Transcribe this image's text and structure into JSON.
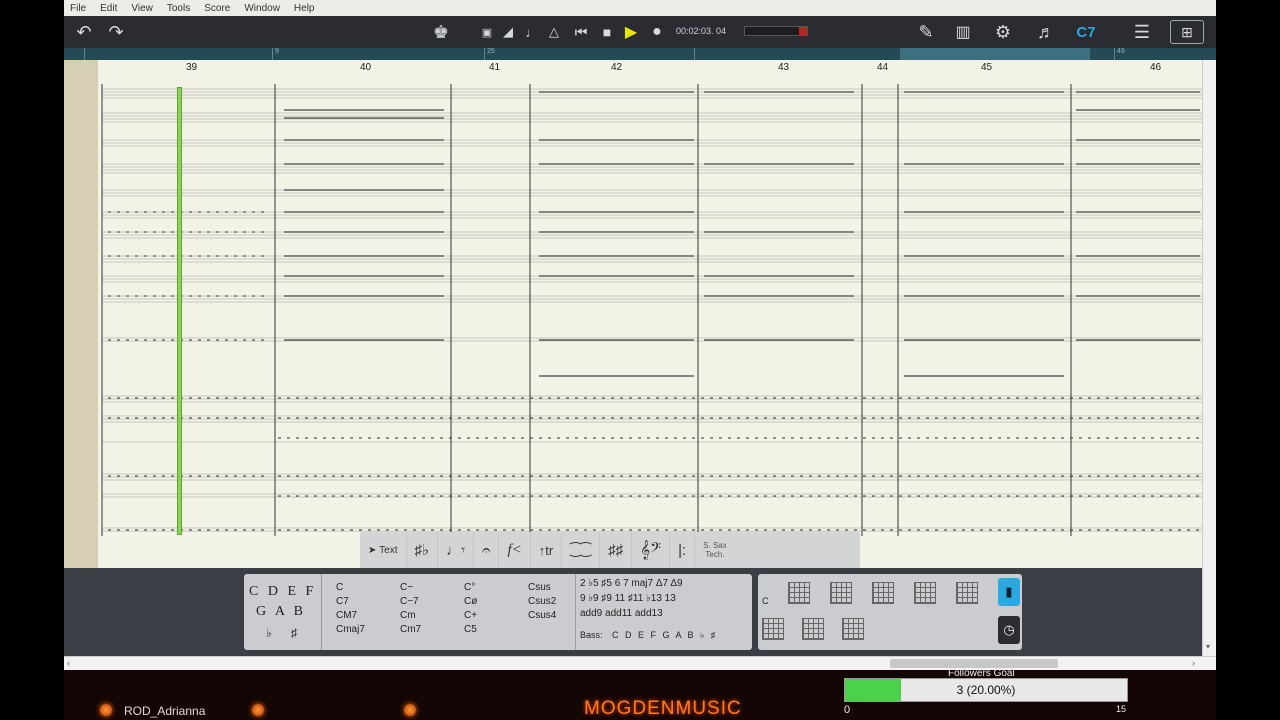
{
  "menu": {
    "file": "File",
    "edit": "Edit",
    "view": "View",
    "tools": "Tools",
    "score": "Score",
    "window": "Window",
    "help": "Help"
  },
  "toolbar": {
    "time": "00:02:03. 04",
    "chord": "C7"
  },
  "timeline": {
    "ticks": [
      "9",
      "25",
      "49"
    ]
  },
  "score": {
    "bars": [
      "39",
      "40",
      "41",
      "42",
      "43",
      "44",
      "45",
      "46"
    ]
  },
  "palette": {
    "text": "Text",
    "sax": "S. Sax",
    "tech": "Tech."
  },
  "chords": {
    "notes_row1": "C D E F",
    "notes_row2": "G A B",
    "accidentals": "♭ ♯",
    "col1": [
      "C",
      "C7",
      "CM7",
      "Cmaj7"
    ],
    "col2": [
      "C−",
      "C−7",
      "Cm",
      "Cm7"
    ],
    "col3": [
      "C°",
      "Cø",
      "C+",
      "C5"
    ],
    "col4": [
      "Csus",
      "Csus2",
      "Csus4"
    ],
    "ext_row1": "2 ♭5 ♯5 6 7 maj7 Δ7 Δ9",
    "ext_row2": "9 ♭9 ♯9 11 ♯11 ♭13 13",
    "ext_row3": "add9 add11 add13",
    "bass_label": "Bass:",
    "bass_notes": "C D E F G A B ♭ ♯",
    "grid_label": "C"
  },
  "stream": {
    "username": "ROD_Adrianna",
    "brand": "MOGDENMUSIC",
    "goal_title": "Followers Goal",
    "goal_value": "3 (20.00%)",
    "goal_min": "0",
    "goal_max": "15",
    "goal_fraction": 0.2,
    "goal_color": "#4ad24a"
  },
  "colors": {
    "accent": "#2aa8e0",
    "cursor": "#8ed15a"
  }
}
